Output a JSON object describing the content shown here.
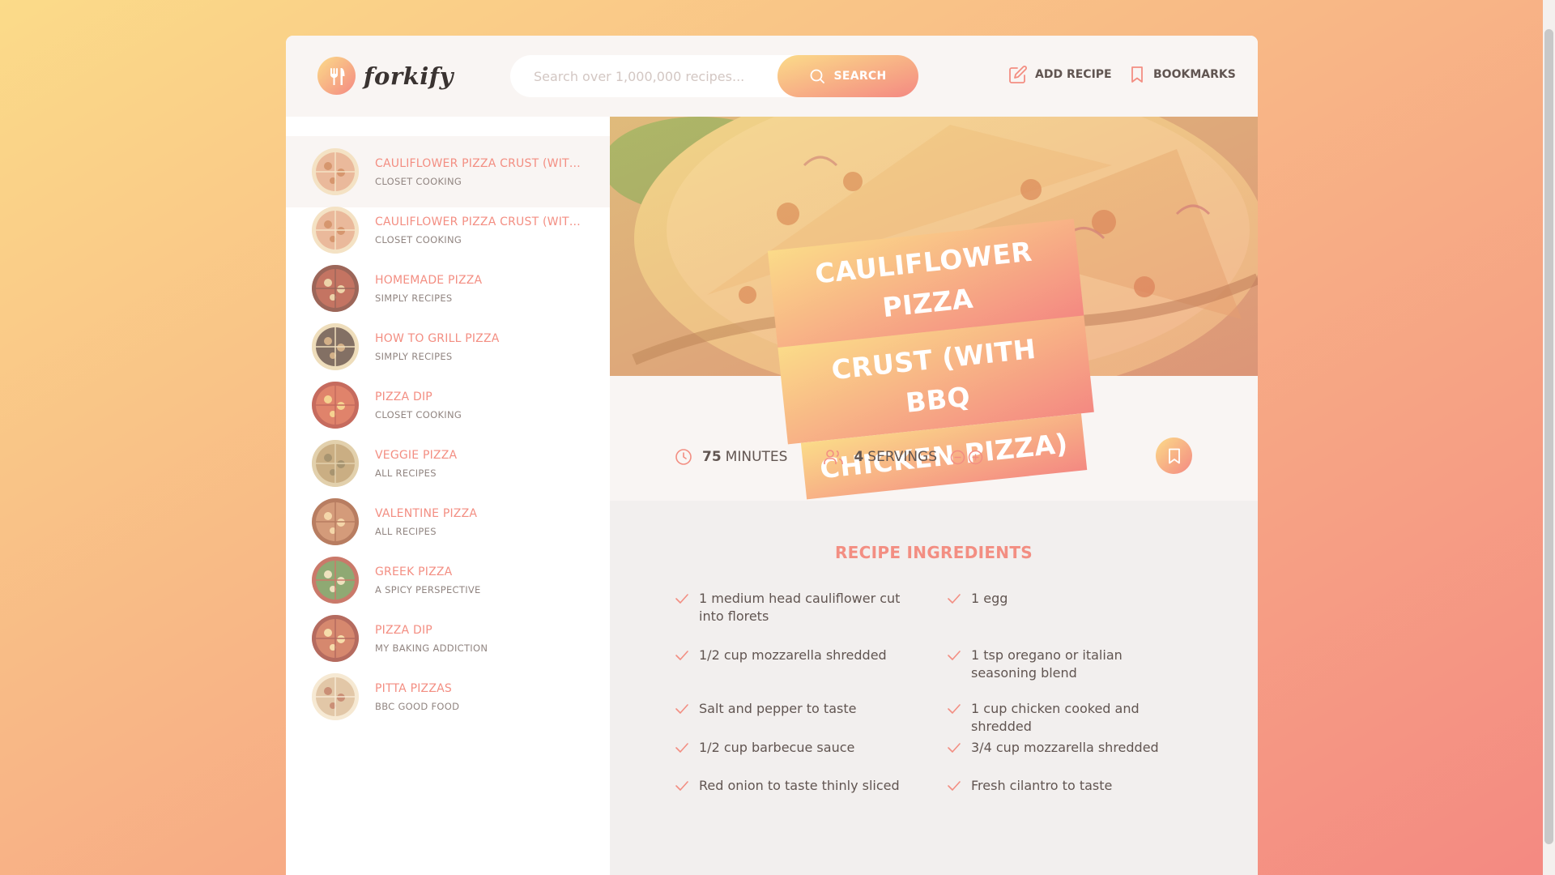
{
  "header": {
    "logo_text": "forkify",
    "search_placeholder": "Search over 1,000,000 recipes...",
    "search_button": "SEARCH",
    "add_recipe": "ADD RECIPE",
    "bookmarks": "BOOKMARKS"
  },
  "results": [
    {
      "title": "CAULIFLOWER PIZZA CRUST (WITH BBQ CHICKEN PIZZA)",
      "publisher": "CLOSET COOKING",
      "active": true
    },
    {
      "title": "CAULIFLOWER PIZZA CRUST (WITH BBQ CHICKEN PIZZA)",
      "publisher": "CLOSET COOKING",
      "active": false
    },
    {
      "title": "HOMEMADE PIZZA",
      "publisher": "SIMPLY RECIPES",
      "active": false
    },
    {
      "title": "HOW TO GRILL PIZZA",
      "publisher": "SIMPLY RECIPES",
      "active": false
    },
    {
      "title": "PIZZA DIP",
      "publisher": "CLOSET COOKING",
      "active": false
    },
    {
      "title": "VEGGIE PIZZA",
      "publisher": "ALL RECIPES",
      "active": false
    },
    {
      "title": "VALENTINE PIZZA",
      "publisher": "ALL RECIPES",
      "active": false
    },
    {
      "title": "GREEK PIZZA",
      "publisher": "A SPICY PERSPECTIVE",
      "active": false
    },
    {
      "title": "PIZZA DIP",
      "publisher": "MY BAKING ADDICTION",
      "active": false
    },
    {
      "title": "PITTA PIZZAS",
      "publisher": "BBC GOOD FOOD",
      "active": false
    }
  ],
  "recipe": {
    "title_lines": [
      "CAULIFLOWER PIZZA",
      "CRUST (WITH BBQ",
      "CHICKEN PIZZA)"
    ],
    "minutes_value": "75",
    "minutes_label": "MINUTES",
    "servings_value": "4",
    "servings_label": "SERVINGS",
    "ingredients_heading": "RECIPE INGREDIENTS",
    "ingredients": [
      "1 medium head cauliflower cut into florets",
      "1 egg",
      "1/2 cup mozzarella shredded",
      "1 tsp oregano or italian seasoning blend",
      "Salt and pepper to taste",
      "1 cup chicken cooked and shredded",
      "1/2 cup barbecue sauce",
      "3/4 cup mozzarella shredded",
      "Red onion to taste thinly sliced",
      "Fresh cilantro to taste"
    ]
  },
  "colors": {
    "accent": "#f38e82",
    "gradient_start": "#fbdb89",
    "gradient_end": "#f48982",
    "panel_bg": "#f9f5f3"
  }
}
